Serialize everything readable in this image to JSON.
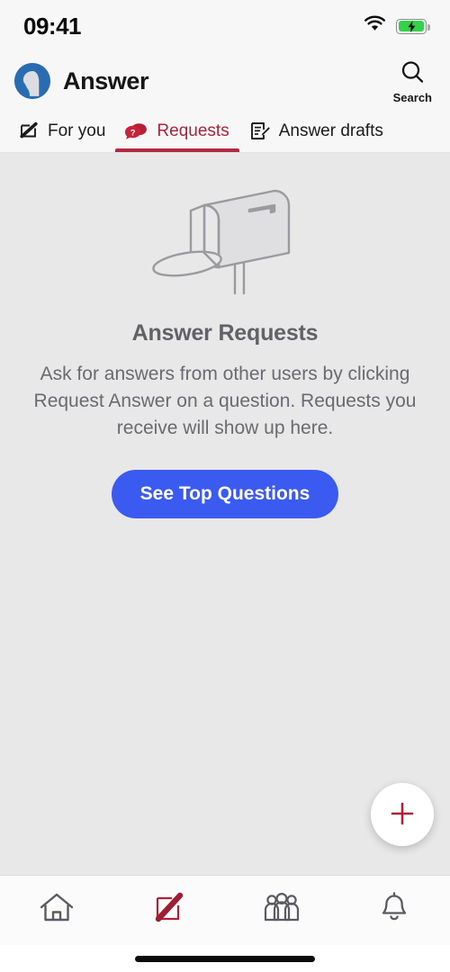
{
  "statusbar": {
    "time": "09:41",
    "wifi_icon": "wifi-icon",
    "battery_icon": "battery-charging-icon"
  },
  "header": {
    "avatar_icon": "user-avatar",
    "title": "Answer",
    "search_icon": "search-icon",
    "search_label": "Search"
  },
  "tabs": [
    {
      "label": "For you",
      "icon": "pencil-square-icon",
      "active": false
    },
    {
      "label": "Requests",
      "icon": "question-speech-bubbles-icon",
      "active": true
    },
    {
      "label": "Answer drafts",
      "icon": "document-pencil-icon",
      "active": false
    }
  ],
  "empty_state": {
    "illustration_icon": "mailbox-icon",
    "title": "Answer Requests",
    "body": "Ask for answers from other users by clicking Request Answer on a question. Requests you receive will show up here.",
    "cta_label": "See Top Questions"
  },
  "fab": {
    "icon": "plus-icon"
  },
  "bottom_nav": [
    {
      "name": "home",
      "icon": "home-icon",
      "active": false
    },
    {
      "name": "answer",
      "icon": "pencil-square-icon",
      "active": true
    },
    {
      "name": "spaces",
      "icon": "people-group-icon",
      "active": false
    },
    {
      "name": "notifications",
      "icon": "bell-icon",
      "active": false
    }
  ],
  "colors": {
    "accent_red": "#b22a42",
    "accent_blue": "#3a5af0",
    "avatar_blue": "#2a6cb0",
    "content_bg": "#e8e8e8",
    "chrome_bg": "#f7f7f8",
    "battery_green": "#34d24a",
    "illustration_gray": "#8e8e93"
  }
}
